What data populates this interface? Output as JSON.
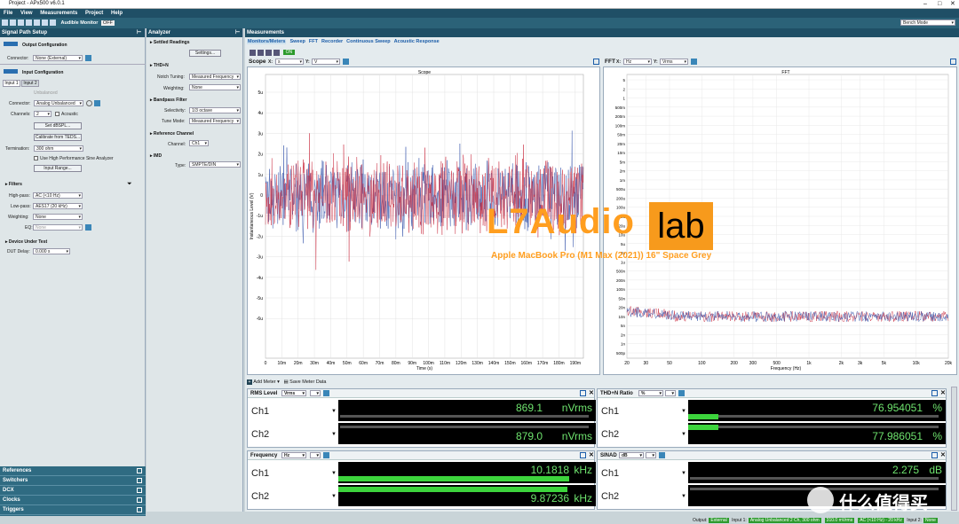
{
  "window": {
    "title": "Project - APx500 v6.0.1"
  },
  "menu": [
    "File",
    "View",
    "Measurements",
    "Project",
    "Help"
  ],
  "toolbar": {
    "audible_monitor": "Audible Monitor",
    "off": "OFF",
    "mode": "Bench Mode"
  },
  "signal_path": {
    "title": "Signal Path Setup",
    "output_config": "Output Configuration",
    "connector_label": "Connector:",
    "output_connector": "None (External)",
    "input_config": "Input Configuration",
    "tab1": "Input 1",
    "tab2": "Input 2",
    "unbalanced": "Unbalanced",
    "input_connector": "Analog Unbalanced",
    "channels_label": "Channels:",
    "channels": "2",
    "acoustic": "Acoustic",
    "set_dbspl": "Set dBSPL...",
    "calibrate": "Calibrate from TEDS...",
    "termination_label": "Termination:",
    "termination": "300 ohm",
    "hp_sine": "Use High Performance Sine Analyzer",
    "input_range": "Input Range...",
    "filters": "Filters",
    "highpass_label": "High-pass:",
    "highpass": "AC (<10 Hz)",
    "lowpass_label": "Low-pass:",
    "lowpass": "AES17 (20 kHz)",
    "weighting_label": "Weighting:",
    "weighting": "None",
    "eq_label": "EQ:",
    "eq": "None",
    "dut": "Device Under Test",
    "dut_delay_label": "DUT Delay:",
    "dut_delay": "0.000 s"
  },
  "bottom_nav": [
    "References",
    "Switchers",
    "DCX",
    "Clocks",
    "Triggers"
  ],
  "analyzer": {
    "title": "Analyzer",
    "settled": "Settled Readings",
    "settings_btn": "Settings...",
    "thdn": "THD+N",
    "notch_label": "Notch Tuning:",
    "notch": "Measured Frequency",
    "weighting_label": "Weighting:",
    "weighting": "None",
    "bandpass": "Bandpass Filter",
    "selectivity_label": "Selectivity:",
    "selectivity": "1/3 octave",
    "tune_label": "Tune Mode:",
    "tune": "Measured Frequency",
    "ref_channel": "Reference Channel",
    "channel_label": "Channel:",
    "channel": "Ch1",
    "imd": "IMD",
    "type_label": "Type:",
    "type": "SMPTE/DIN"
  },
  "measurements": {
    "title": "Measurements",
    "tabs": [
      "Monitors/Meters",
      "Sweep",
      "FFT",
      "Recorder",
      "Continuous Sweep",
      "Acoustic Response"
    ],
    "on": "ON"
  },
  "scope": {
    "label": "Scope",
    "x_unit": "s",
    "y_unit": "V",
    "title": "Scope",
    "ylabel": "Instantaneous Level (V)",
    "xlabel": "Time (s)"
  },
  "fft": {
    "label": "FFT",
    "x_unit": "Hz",
    "y_unit": "Vrms",
    "title": "FFT",
    "xlabel": "Frequency (Hz)"
  },
  "chart_data": [
    {
      "type": "line",
      "title": "Scope",
      "xlabel": "Time (s)",
      "ylabel": "Instantaneous Level (V)",
      "x_ticks": [
        "0",
        "10m",
        "20m",
        "30m",
        "40m",
        "50m",
        "60m",
        "70m",
        "80m",
        "90m",
        "100m",
        "110m",
        "120m",
        "130m",
        "140m",
        "150m",
        "160m",
        "170m",
        "180m",
        "190m"
      ],
      "y_ticks": [
        "5u",
        "4u",
        "3u",
        "2u",
        "1u",
        "0",
        "-1u",
        "-2u",
        "-3u",
        "-4u",
        "-5u",
        "-6u"
      ],
      "xlim": [
        0,
        0.195
      ],
      "ylim": [
        -6,
        6
      ],
      "series": [
        {
          "color": "#c8283c",
          "envelope": 2.1
        },
        {
          "color": "#2f4fa8",
          "envelope": 1.9
        }
      ]
    },
    {
      "type": "line",
      "title": "FFT",
      "xlabel": "Frequency (Hz)",
      "x_scale": "log",
      "y_scale": "log",
      "x_ticks": [
        "20",
        "30",
        "50",
        "100",
        "200",
        "300",
        "500",
        "1k",
        "2k",
        "3k",
        "5k",
        "10k",
        "20k"
      ],
      "y_ticks": [
        "5",
        "2",
        "1",
        "500m",
        "200m",
        "100m",
        "50m",
        "20m",
        "10m",
        "5m",
        "2m",
        "1m",
        "500u",
        "200u",
        "100u",
        "50u",
        "20u",
        "10u",
        "5u",
        "2u",
        "1u",
        "500n",
        "200n",
        "100n",
        "50n",
        "20n",
        "10n",
        "5n",
        "2n",
        "1n",
        "500p"
      ],
      "xlim": [
        20,
        20000
      ],
      "series": [
        {
          "color": "#c8283c",
          "level": "10n"
        },
        {
          "color": "#2f4fa8",
          "level": "10n"
        }
      ]
    }
  ],
  "meters": {
    "add_meter": "Add Meter",
    "save_meter": "Save Meter Data",
    "rms": {
      "label": "RMS Level",
      "unit_sel": "Vrms",
      "ch1": "Ch1",
      "ch2": "Ch2",
      "v1": "869.1",
      "v2": "879.0",
      "u1": "nVrms",
      "u2": "nVrms"
    },
    "thdn": {
      "label": "THD+N Ratio",
      "unit_sel": "%",
      "ch1": "Ch1",
      "ch2": "Ch2",
      "v1": "76.954051",
      "v2": "77.986051",
      "u1": "%",
      "u2": "%"
    },
    "freq": {
      "label": "Frequency",
      "unit_sel": "Hz",
      "ch1": "Ch1",
      "ch2": "Ch2",
      "v1": "10.1818",
      "v2": "9.87236",
      "u1": "kHz",
      "u2": "kHz"
    },
    "sinad": {
      "label": "SINAD",
      "unit_sel": "dB",
      "ch1": "Ch1",
      "ch2": "Ch2",
      "v1": "2.275",
      "v2": "",
      "u1": "dB",
      "u2": ""
    }
  },
  "status": {
    "output_label": "Output:",
    "output": "External",
    "input1_label": "Input 1:",
    "input1": "Analog Unbalanced 2 Ch, 300 ohm",
    "level": "310.0 mVrms",
    "filter": "AC (<10 Hz) - 20 kHz",
    "input2_label": "Input 2:",
    "input2": "None"
  },
  "watermark": {
    "brand_a": "L7Audio",
    "brand_b": "lab",
    "subtitle": "Apple MacBook Pro (M1 Max (2021)) 16\" Space Grey",
    "site": "什么值得买"
  }
}
